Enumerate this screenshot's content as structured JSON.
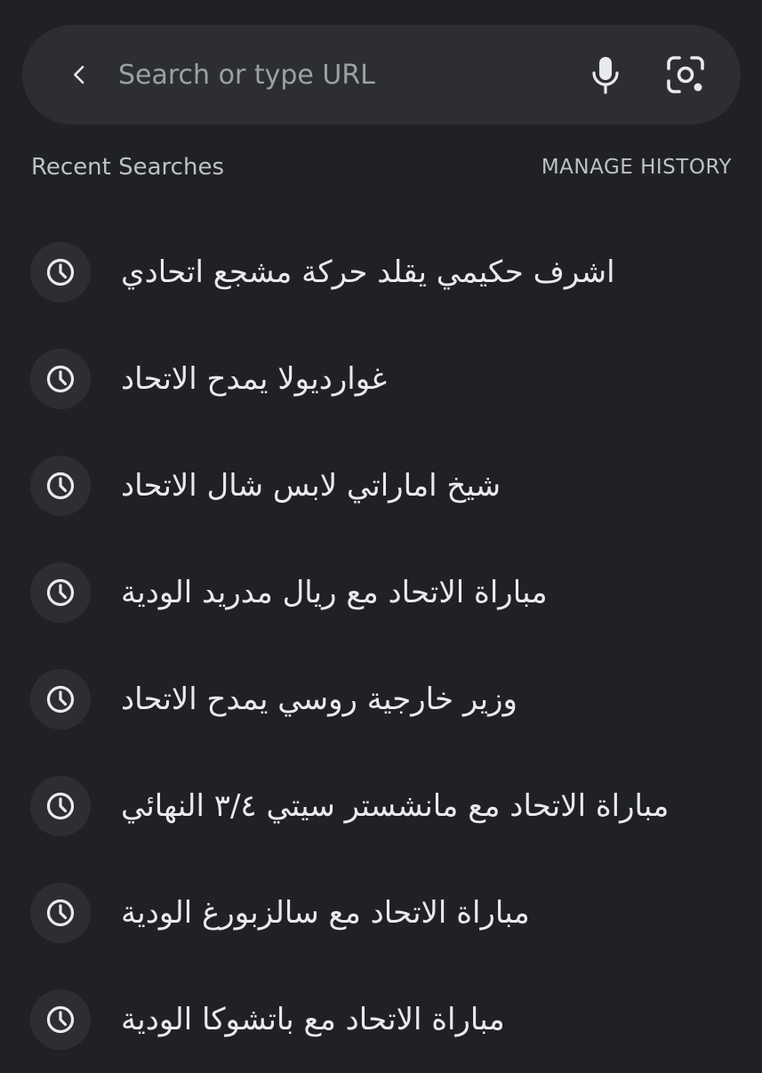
{
  "search": {
    "placeholder": "Search or type URL",
    "value": ""
  },
  "recent": {
    "title": "Recent Searches",
    "manage_label": "MANAGE HISTORY"
  },
  "history": [
    {
      "text": "اشرف حكيمي يقلد حركة مشجع اتحادي",
      "icon": "history-icon"
    },
    {
      "text": "غوارديولا يمدح الاتحاد",
      "icon": "history-icon"
    },
    {
      "text": "شيخ اماراتي لابس شال الاتحاد",
      "icon": "history-icon"
    },
    {
      "text": "مباراة الاتحاد مع ريال مدريد الودية",
      "icon": "history-icon"
    },
    {
      "text": "وزير خارجية روسي يمدح الاتحاد",
      "icon": "history-icon"
    },
    {
      "text": "مباراة الاتحاد مع مانشستر سيتي ٣/٤ النهائي",
      "icon": "history-icon"
    },
    {
      "text": "مباراة الاتحاد مع سالزبورغ الودية",
      "icon": "history-icon"
    },
    {
      "text": "مباراة الاتحاد مع باتشوكا الودية",
      "icon": "history-icon"
    }
  ],
  "colors": {
    "background": "#202124",
    "surface": "#2d2e31",
    "text_primary": "#e8eaed",
    "text_secondary": "#bdc1c6",
    "placeholder": "#9aa0a6"
  }
}
